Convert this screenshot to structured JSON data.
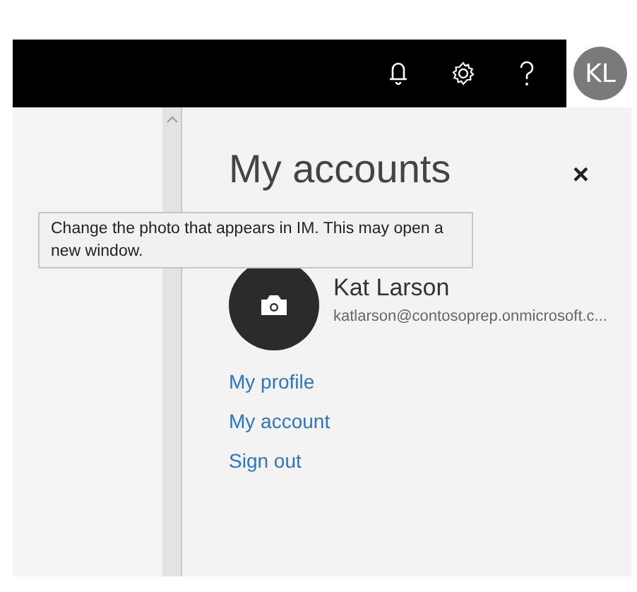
{
  "top_bar": {
    "avatar_initials": "KL"
  },
  "panel": {
    "title": "My accounts",
    "close": "×",
    "tooltip": "Change the photo that appears in IM. This may open a new window.",
    "account": {
      "name": "Kat Larson",
      "email": "katlarson@contosoprep.onmicrosoft.c..."
    },
    "links": [
      "My profile",
      "My account",
      "Sign out"
    ]
  }
}
